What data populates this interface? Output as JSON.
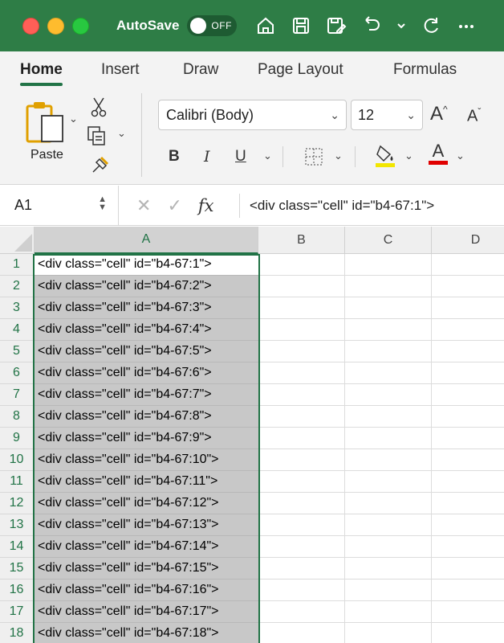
{
  "titlebar": {
    "autosave_label": "AutoSave",
    "toggle_state": "OFF",
    "icons": [
      "home-icon",
      "save-icon",
      "save-as-icon",
      "undo-icon",
      "undo-dropdown-icon",
      "redo-icon",
      "more-icon"
    ]
  },
  "tabs": [
    "Home",
    "Insert",
    "Draw",
    "Page Layout",
    "Formulas"
  ],
  "ribbon": {
    "paste_label": "Paste",
    "font_name": "Calibri (Body)",
    "font_size": "12",
    "bold": "B",
    "italic": "I",
    "underline": "U",
    "font_color_letter": "A",
    "grow_letter": "A",
    "shrink_letter": "A",
    "fill_color": "#f2e600",
    "font_color": "#e00000"
  },
  "formula_bar": {
    "name_box": "A1",
    "fx_label": "fx",
    "content": "<div class=\"cell\" id=\"b4-67:1\">"
  },
  "grid": {
    "columns": [
      "A",
      "B",
      "C",
      "D"
    ],
    "selected_column": "A",
    "rows": [
      {
        "num": "1",
        "a": "<div class=\"cell\" id=\"b4-67:1\">"
      },
      {
        "num": "2",
        "a": "<div class=\"cell\" id=\"b4-67:2\">"
      },
      {
        "num": "3",
        "a": "<div class=\"cell\" id=\"b4-67:3\">"
      },
      {
        "num": "4",
        "a": "<div class=\"cell\" id=\"b4-67:4\">"
      },
      {
        "num": "5",
        "a": "<div class=\"cell\" id=\"b4-67:5\">"
      },
      {
        "num": "6",
        "a": "<div class=\"cell\" id=\"b4-67:6\">"
      },
      {
        "num": "7",
        "a": "<div class=\"cell\" id=\"b4-67:7\">"
      },
      {
        "num": "8",
        "a": "<div class=\"cell\" id=\"b4-67:8\">"
      },
      {
        "num": "9",
        "a": "<div class=\"cell\" id=\"b4-67:9\">"
      },
      {
        "num": "10",
        "a": "<div class=\"cell\" id=\"b4-67:10\">"
      },
      {
        "num": "11",
        "a": "<div class=\"cell\" id=\"b4-67:11\">"
      },
      {
        "num": "12",
        "a": "<div class=\"cell\" id=\"b4-67:12\">"
      },
      {
        "num": "13",
        "a": "<div class=\"cell\" id=\"b4-67:13\">"
      },
      {
        "num": "14",
        "a": "<div class=\"cell\" id=\"b4-67:14\">"
      },
      {
        "num": "15",
        "a": "<div class=\"cell\" id=\"b4-67:15\">"
      },
      {
        "num": "16",
        "a": "<div class=\"cell\" id=\"b4-67:16\">"
      },
      {
        "num": "17",
        "a": "<div class=\"cell\" id=\"b4-67:17\">"
      },
      {
        "num": "18",
        "a": "<div class=\"cell\" id=\"b4-67:18\">"
      }
    ]
  },
  "colors": {
    "title_bar": "#2e7d46",
    "accent": "#217346",
    "selection_fill": "#c8c8c8"
  }
}
